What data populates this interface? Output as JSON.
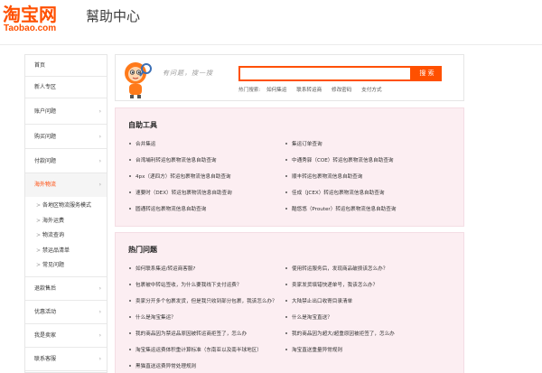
{
  "header": {
    "logo_main": "淘宝网",
    "logo_sub": "Taobao.com",
    "title": "幫助中心"
  },
  "sidebar": {
    "items_top": [
      {
        "label": "首页",
        "arrow": ""
      },
      {
        "label": "新人专区",
        "arrow": ""
      },
      {
        "label": "账户问题",
        "arrow": "›"
      },
      {
        "label": "购买问题",
        "arrow": "›"
      },
      {
        "label": "付款问题",
        "arrow": "›"
      }
    ],
    "active": {
      "label": "海外物流",
      "arrow": "›"
    },
    "sub_items": [
      "各地区物流服务模式",
      "海外运费",
      "物流查询",
      "禁运品清单",
      "常见问题"
    ],
    "items_bottom": [
      {
        "label": "退款售后",
        "arrow": "›"
      },
      {
        "label": "优惠活动",
        "arrow": "›"
      },
      {
        "label": "我是卖家",
        "arrow": "›"
      },
      {
        "label": "联系客服",
        "arrow": "›"
      }
    ],
    "sub_marker": ">"
  },
  "search": {
    "slogan": "有问题，搜一搜",
    "placeholder": "",
    "button_label": "搜 索",
    "hot_label": "热门搜索:",
    "hot_links": [
      "如何集运",
      "联系转运商",
      "修改密码",
      "支付方式"
    ]
  },
  "tools": {
    "title": "自助工具",
    "left": [
      "合并集运",
      "台湾埔利转运包裹物流信息自助查询",
      "4px（递四方）转运包裹物流信息自助查询",
      "速要时（DEX）转运包裹物流信息自助查询",
      "圆通转运包裹物流信息自助查询"
    ],
    "right": [
      "集运订单查询",
      "中通秀驿（COE）转运包裹物流信息自助查询",
      "顺丰转运包裹物流信息自助查询",
      "佳成（JCEX）转运包裹物流信息自助查询",
      "酷悠悠（Prouter）转运包裹物流信息自助查询"
    ]
  },
  "faq": {
    "title": "热门问题",
    "left": [
      "如何联系集运/转运商客服?",
      "包裹被中转站签收，为什么要我线下支付运费？",
      "卖家分开多个包裹发货，但是我只收到部分包裹，我该怎么办？",
      "什么是淘宝集运？",
      "我的商品因为禁运品原因被转运商拒签了，怎么办",
      "淘宝集运运费体积重计算标准（东南亚以及南半球地区）",
      "黑猫直送运费异常处理规则"
    ],
    "right": [
      "使用转运服务后，发现商品破损该怎么办？",
      "卖家发货填错快递单号，我该怎么办？",
      "大陆禁止出口收寄目录清单",
      "什么是淘宝直送？",
      "我的商品因为超大/超重原因被拒签了，怎么办",
      "淘宝直送重量异常规则"
    ]
  },
  "colors": {
    "brand": "#ff5000",
    "panel_bg": "#fceef2",
    "active_text": "#ff4400"
  }
}
